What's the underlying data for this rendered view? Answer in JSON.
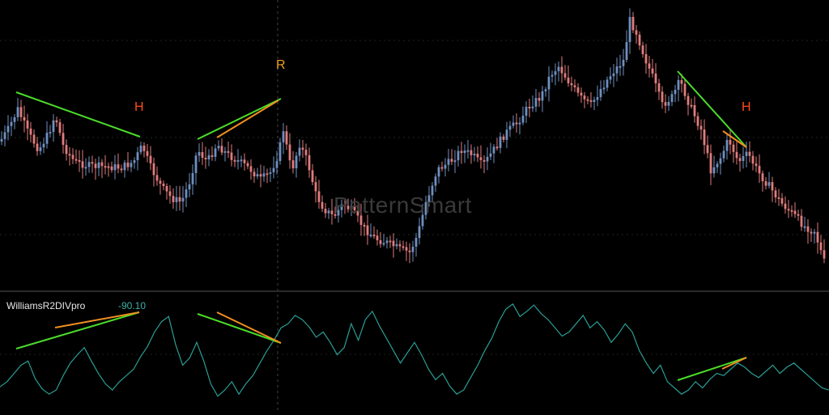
{
  "watermark": "PatternSmart",
  "indicator": {
    "name": "WilliamsR2DIVpro",
    "value": "-90.10",
    "line_color": "#2a9d94"
  },
  "markers": [
    {
      "label": "H",
      "color": "#ff4a1a"
    },
    {
      "label": "R",
      "color": "#f0a020"
    },
    {
      "label": "H",
      "color": "#ff4a1a"
    }
  ],
  "colors": {
    "bull_candle": "#6f8fc0",
    "bear_candle": "#e07c7c",
    "divergence_major": "#4cdc2a",
    "divergence_minor": "#f09020",
    "grid": "#222222"
  },
  "chart_data": [
    {
      "type": "candlestick",
      "title": "",
      "close_trace": [
        [
          0,
          175
        ],
        [
          10,
          160
        ],
        [
          22,
          135
        ],
        [
          35,
          165
        ],
        [
          48,
          185
        ],
        [
          60,
          165
        ],
        [
          68,
          142
        ],
        [
          78,
          180
        ],
        [
          92,
          200
        ],
        [
          110,
          205
        ],
        [
          130,
          206
        ],
        [
          150,
          207
        ],
        [
          165,
          200
        ],
        [
          176,
          180
        ],
        [
          185,
          205
        ],
        [
          200,
          232
        ],
        [
          212,
          245
        ],
        [
          224,
          250
        ],
        [
          234,
          225
        ],
        [
          244,
          185
        ],
        [
          256,
          200
        ],
        [
          268,
          178
        ],
        [
          280,
          190
        ],
        [
          296,
          200
        ],
        [
          310,
          210
        ],
        [
          322,
          222
        ],
        [
          334,
          213
        ],
        [
          344,
          190
        ],
        [
          350,
          160
        ],
        [
          360,
          212
        ],
        [
          370,
          178
        ],
        [
          380,
          200
        ],
        [
          390,
          240
        ],
        [
          400,
          258
        ],
        [
          412,
          268
        ],
        [
          424,
          252
        ],
        [
          436,
          262
        ],
        [
          450,
          282
        ],
        [
          464,
          295
        ],
        [
          478,
          300
        ],
        [
          494,
          308
        ],
        [
          506,
          312
        ],
        [
          516,
          290
        ],
        [
          526,
          250
        ],
        [
          540,
          210
        ],
        [
          556,
          200
        ],
        [
          570,
          185
        ],
        [
          584,
          192
        ],
        [
          596,
          205
        ],
        [
          610,
          185
        ],
        [
          624,
          165
        ],
        [
          640,
          150
        ],
        [
          654,
          130
        ],
        [
          668,
          120
        ],
        [
          680,
          92
        ],
        [
          690,
          82
        ],
        [
          702,
          100
        ],
        [
          716,
          120
        ],
        [
          730,
          130
        ],
        [
          742,
          110
        ],
        [
          756,
          90
        ],
        [
          770,
          75
        ],
        [
          778,
          25
        ],
        [
          786,
          40
        ],
        [
          796,
          70
        ],
        [
          806,
          95
        ],
        [
          818,
          130
        ],
        [
          830,
          120
        ],
        [
          840,
          100
        ],
        [
          852,
          130
        ],
        [
          866,
          160
        ],
        [
          878,
          210
        ],
        [
          890,
          195
        ],
        [
          900,
          172
        ],
        [
          912,
          200
        ],
        [
          924,
          190
        ],
        [
          936,
          212
        ],
        [
          950,
          230
        ],
        [
          964,
          250
        ],
        [
          980,
          265
        ],
        [
          994,
          280
        ],
        [
          1006,
          285
        ],
        [
          1020,
          330
        ]
      ],
      "divergence_lines": [
        {
          "pair": 1,
          "color": "major"
        },
        {
          "pair": 2,
          "color": "major"
        },
        {
          "pair": 2,
          "color": "minor"
        },
        {
          "pair": 3,
          "color": "major"
        },
        {
          "pair": 3,
          "color": "minor"
        }
      ]
    },
    {
      "type": "line",
      "title": "",
      "series_values": [
        "-83",
        "-78",
        "-70",
        "-62",
        "-58",
        "-75",
        "-85",
        "-90",
        "-86",
        "-72",
        "-60",
        "-52",
        "-45",
        "-58",
        "-70",
        "-80",
        "-86",
        "-78",
        "-72",
        "-66",
        "-54",
        "-44",
        "-30",
        "-20",
        "-15",
        "-42",
        "-62",
        "-55",
        "-40",
        "-58",
        "-80",
        "-92",
        "-86",
        "-78",
        "-90",
        "-80",
        "-72",
        "-60",
        "-48",
        "-38",
        "-26",
        "-22",
        "-14",
        "-18",
        "-25",
        "-35",
        "-30",
        "-40",
        "-52",
        "-45",
        "-22",
        "-38",
        "-18",
        "-10",
        "-24",
        "-36",
        "-48",
        "-60",
        "-50",
        "-40",
        "-52",
        "-66",
        "-76",
        "-70",
        "-82",
        "-90",
        "-86",
        "-74",
        "-62",
        "-48",
        "-36",
        "-20",
        "-8",
        "-3",
        "-15",
        "-10",
        "-4",
        "-12",
        "-18",
        "-26",
        "-34",
        "-30",
        "-22",
        "-14",
        "-26",
        "-20",
        "-28",
        "-40",
        "-32",
        "-22",
        "-30",
        "-48",
        "-60",
        "-70",
        "-62",
        "-78",
        "-84",
        "-90",
        "-86",
        "-78",
        "-84",
        "-76",
        "-70",
        "-72",
        "-66",
        "-60",
        "-64",
        "-70",
        "-74",
        "-68",
        "-62",
        "-70",
        "-64",
        "-60",
        "-66",
        "-72",
        "-78",
        "-84",
        "-86"
      ],
      "ylim": [
        -100,
        0
      ],
      "divergence_lines": [
        {
          "pair": 1,
          "color": "major"
        },
        {
          "pair": 1,
          "color": "minor"
        },
        {
          "pair": 2,
          "color": "major"
        },
        {
          "pair": 2,
          "color": "minor"
        },
        {
          "pair": 3,
          "color": "major"
        },
        {
          "pair": 3,
          "color": "minor"
        }
      ]
    }
  ]
}
